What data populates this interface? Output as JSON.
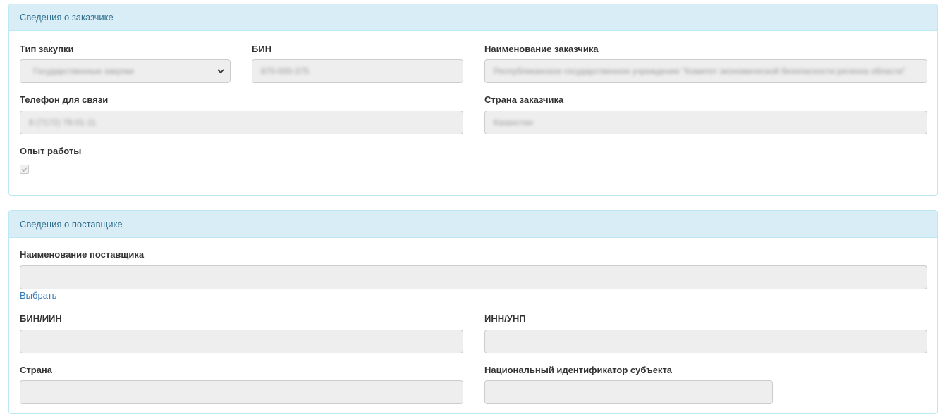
{
  "customer": {
    "heading": "Сведения о заказчике",
    "purchase_type_label": "Тип закупки",
    "purchase_type_value": "Государственные закупки",
    "bin_label": "БИН",
    "bin_value": "870-000-375",
    "customer_name_label": "Наименование заказчика",
    "customer_name_value": "Республиканское государственное учреждение \"Комитет экономической безопасности региона области\"",
    "phone_label": "Телефон для связи",
    "phone_value": "8 (7172) 78-01-11",
    "country_label": "Страна заказчика",
    "country_value": "Казахстан",
    "experience_label": "Опыт работы",
    "experience_checked": true
  },
  "supplier": {
    "heading": "Сведения о поставщике",
    "supplier_name_label": "Наименование поставщика",
    "supplier_name_value": "",
    "select_link": "Выбрать",
    "bin_iin_label": "БИН/ИИН",
    "bin_iin_value": "",
    "inn_unp_label": "ИНН/УНП",
    "inn_unp_value": "",
    "country_label": "Страна",
    "country_value": "",
    "national_id_label": "Национальный идентификатор субъекта",
    "national_id_value": ""
  },
  "colors": {
    "panel_heading_bg": "#d9edf7",
    "panel_border": "#bce8f1",
    "heading_text": "#31708f",
    "readonly_bg": "#eeeeee",
    "link": "#337ab7"
  }
}
